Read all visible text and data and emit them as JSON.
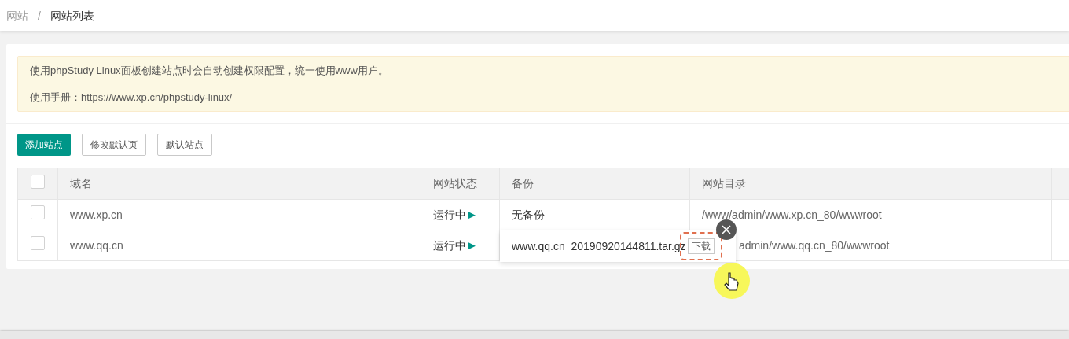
{
  "breadcrumb": [
    {
      "label": "网站",
      "current": false
    },
    {
      "label": "网站列表",
      "current": true
    }
  ],
  "breadcrumb_separator": "/",
  "notice": {
    "lines": [
      "使用phpStudy Linux面板创建站点时会自动创建权限配置，统一使用www用户。",
      "使用手册：https://www.xp.cn/phpstudy-linux/"
    ]
  },
  "buttons": [
    {
      "label": "添加站点",
      "kind": "primary"
    },
    {
      "label": "修改默认页",
      "kind": "default"
    },
    {
      "label": "默认站点",
      "kind": "default"
    }
  ],
  "table": {
    "columns": [
      "域名",
      "网站状态",
      "备份",
      "网站目录"
    ],
    "select_all": {
      "checked": false
    },
    "rows": [
      {
        "checked": false,
        "domain": "www.xp.cn",
        "status": "运行中",
        "status_icon": "▶",
        "backup": {
          "kind": "text",
          "text": "无备份"
        },
        "dir": "/www/admin/www.xp.cn_80/wwwroot"
      },
      {
        "checked": false,
        "domain": "www.qq.cn",
        "status": "运行中",
        "status_icon": "▶",
        "backup": {
          "kind": "popup",
          "text": "www.qq.cn_20190920144811.tar.gz",
          "button": "下载"
        },
        "dir": "admin/www.qq.cn_80/wwwroot"
      }
    ]
  }
}
